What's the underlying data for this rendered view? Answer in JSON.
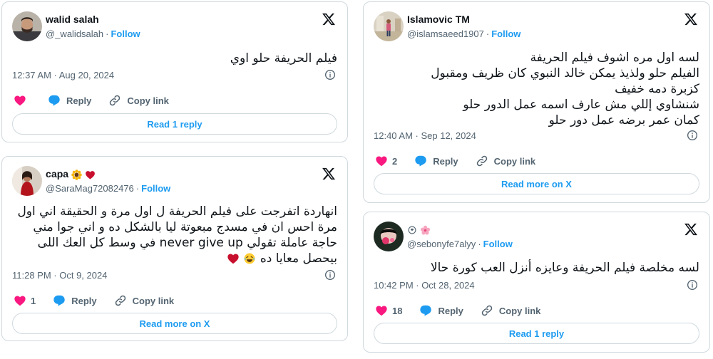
{
  "colors": {
    "accent": "#1d9bf0",
    "like": "#f91880",
    "text": "#0f1419",
    "muted": "#536471",
    "border": "#cfd9de"
  },
  "tweets": [
    {
      "display_name": "walid salah",
      "handle": "@_walidsalah",
      "follow_label": "Follow",
      "text_lines": [
        "فيلم الحريفة حلو اوي"
      ],
      "timestamp": "12:37 AM · Aug 20, 2024",
      "like_count": "",
      "reply_label": "Reply",
      "copy_label": "Copy link",
      "button_label": "Read 1 reply"
    },
    {
      "display_name": "сара",
      "handle": "@SaraMag72082476",
      "follow_label": "Follow",
      "text_lines": [
        "انهاردة اتفرجت على فيلم الحريفة ل اول مرة و الحقيقة اني اول",
        "مرة احس ان في مسدج مبعوتة ليا بالشكل ده و اني جوا مني",
        "حاجة عاملة تقولي never give up في وسط كل العك اللى",
        "بيحصل معايا ده"
      ],
      "timestamp": "11:28 PM · Oct 9, 2024",
      "like_count": "1",
      "reply_label": "Reply",
      "copy_label": "Copy link",
      "button_label": "Read more on X"
    },
    {
      "display_name": "Islamovic TM",
      "handle": "@islamsaeed1907",
      "follow_label": "Follow",
      "text_lines": [
        "لسه اول مره اشوف فيلم الحريفة",
        "الفيلم حلو ولذيذ يمكن خالد النبوي كان ظريف ومقبول",
        "كزبرة دمه خفيف",
        "شنشاوي إللي مش عارف اسمه عمل الدور حلو",
        "كمان عمر برضه عمل دور حلو"
      ],
      "timestamp": "12:40 AM · Sep 12, 2024",
      "like_count": "2",
      "reply_label": "Reply",
      "copy_label": "Copy link",
      "button_label": "Read more on X"
    },
    {
      "display_name": "",
      "handle": "@sebonyfe7alyy",
      "follow_label": "Follow",
      "text_lines": [
        "لسه مخلصة فيلم الحريفة وعايزه أنزل العب كورة حالا"
      ],
      "timestamp": "10:42 PM · Oct 28, 2024",
      "like_count": "18",
      "reply_label": "Reply",
      "copy_label": "Copy link",
      "button_label": "Read 1 reply"
    }
  ]
}
